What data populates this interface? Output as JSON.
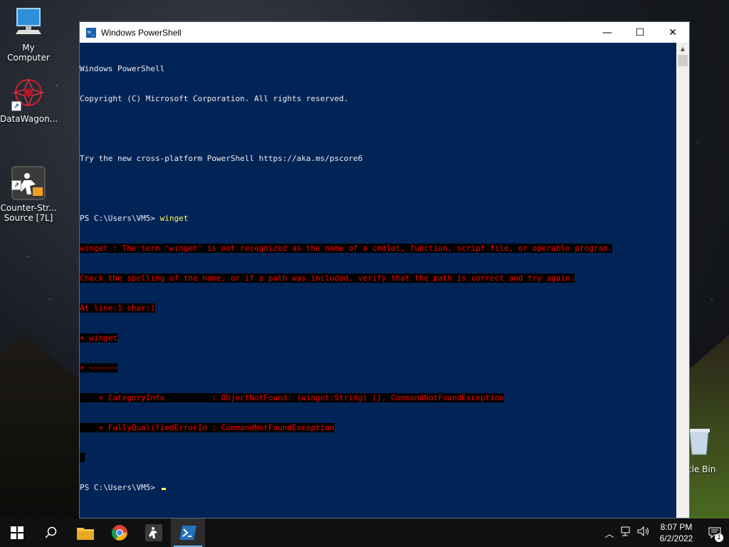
{
  "desktop": {
    "icons": [
      {
        "label": "My Computer"
      },
      {
        "label": "DataWagon..."
      },
      {
        "label": "Counter-Str...\nSource [7L]"
      }
    ],
    "recycle_bin_label": "cle Bin"
  },
  "window": {
    "title": "Windows PowerShell",
    "minimize": "—",
    "maximize": "☐",
    "close": "✕"
  },
  "console": {
    "header": [
      "Windows PowerShell",
      "Copyright (C) Microsoft Corporation. All rights reserved.",
      "",
      "Try the new cross-platform PowerShell https://aka.ms/pscore6",
      ""
    ],
    "prompt1": "PS C:\\Users\\VM5> ",
    "command1": "winget",
    "errors": [
      "winget : The term 'winget' is not recognized as the name of a cmdlet, function, script file, or operable program.",
      "Check the spelling of the name, or if a path was included, verify that the path is correct and try again.",
      "At line:1 char:1",
      "+ winget",
      "+ ~~~~~~",
      "    + CategoryInfo          : ObjectNotFound: (winget:String) [], CommandNotFoundException",
      "    + FullyQualifiedErrorId : CommandNotFoundException",
      " "
    ],
    "prompt2": "PS C:\\Users\\VM5> "
  },
  "taskbar": {
    "items": [
      "start-icon",
      "search-icon",
      "file-explorer-icon",
      "chrome-icon",
      "counter-strike-icon",
      "powershell-icon"
    ],
    "time": "8:07 PM",
    "date": "6/2/2022",
    "notification_count": "1"
  },
  "colors": {
    "console_bg": "#012456",
    "error_fg": "#ff0000",
    "command_fg": "#ffff66"
  }
}
